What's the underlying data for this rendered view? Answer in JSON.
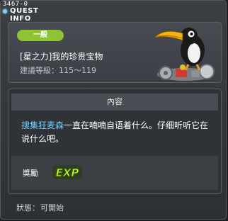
{
  "window": {
    "quest_id": "3467-0",
    "title": "QUEST INFO"
  },
  "quest": {
    "category": "一般",
    "name": "[星之力]我的珍贵宝物",
    "level_requirement": "建議等級：115～119"
  },
  "content": {
    "header": "內容",
    "npc_name": "搜集狂麦森",
    "description": "一直在喃喃自语着什么。仔细听听它在说什么吧。",
    "reward_label": "獎勵",
    "reward_icon": "exp-icon",
    "reward_text": "EXP"
  },
  "status": {
    "label": "狀態：",
    "value": "可開始"
  },
  "colors": {
    "badge": "#8fc336",
    "npc_name": "#6ed0ff",
    "exp_text": "#c8ff3a"
  }
}
